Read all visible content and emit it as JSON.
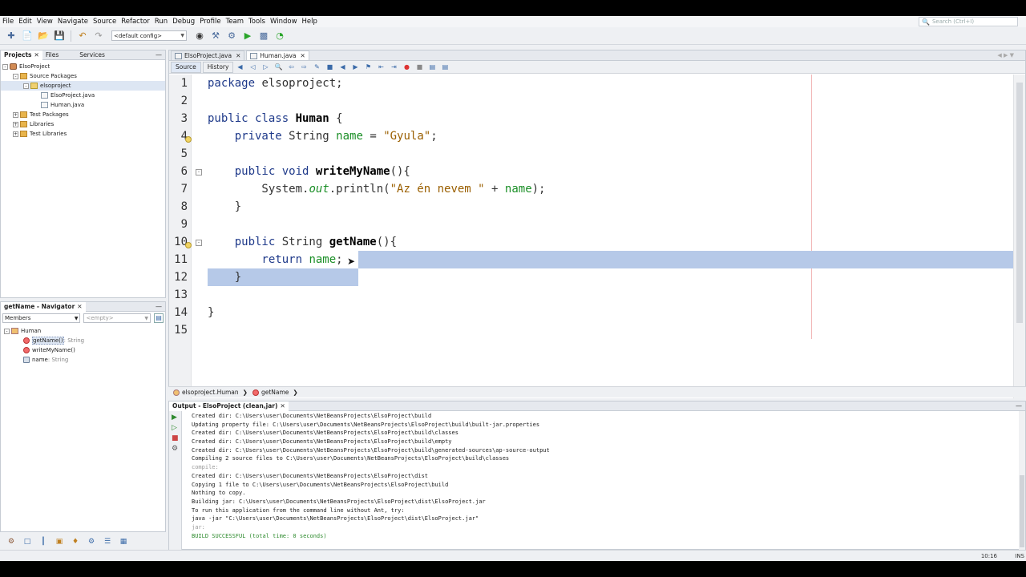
{
  "menu": [
    "File",
    "Edit",
    "View",
    "Navigate",
    "Source",
    "Refactor",
    "Run",
    "Debug",
    "Profile",
    "Team",
    "Tools",
    "Window",
    "Help"
  ],
  "search": {
    "placeholder": "Search (Ctrl+I)"
  },
  "toolbar": {
    "config": "<default config>"
  },
  "projects": {
    "tabs": [
      "Projects",
      "Files",
      "Services"
    ],
    "tree": [
      {
        "label": "ElsoProject",
        "indent": 0,
        "icon": "proj",
        "toggle": "-"
      },
      {
        "label": "Source Packages",
        "indent": 1,
        "icon": "folder",
        "toggle": "-"
      },
      {
        "label": "elsoproject",
        "indent": 2,
        "icon": "pkg",
        "toggle": "-",
        "selected": true
      },
      {
        "label": "ElsoProject.java",
        "indent": 3,
        "icon": "jfile",
        "toggle": ""
      },
      {
        "label": "Human.java",
        "indent": 3,
        "icon": "jfile",
        "toggle": ""
      },
      {
        "label": "Test Packages",
        "indent": 1,
        "icon": "folder",
        "toggle": "+"
      },
      {
        "label": "Libraries",
        "indent": 1,
        "icon": "folder",
        "toggle": "+"
      },
      {
        "label": "Test Libraries",
        "indent": 1,
        "icon": "folder",
        "toggle": "+"
      }
    ]
  },
  "navigator": {
    "tab": "getName - Navigator",
    "members": "Members",
    "filter": "<empty>",
    "class": "Human",
    "items": [
      {
        "name": "getName()",
        "type": " : String",
        "selected": true
      },
      {
        "name": "writeMyName()",
        "type": ""
      },
      {
        "name": "name",
        "type": " : String"
      }
    ]
  },
  "editor": {
    "tabs": [
      {
        "label": "ElsoProject.java",
        "active": false
      },
      {
        "label": "Human.java",
        "active": true
      }
    ],
    "source_tab": "Source",
    "history_tab": "History",
    "line_numbers": [
      "1",
      "2",
      "3",
      "4",
      "5",
      "6",
      "7",
      "8",
      "9",
      "10",
      "11",
      "12",
      "13",
      "14",
      "15"
    ],
    "code": {
      "l1_a": "package",
      "l1_b": " elsoproject;",
      "l3_a": "public class ",
      "l3_b": "Human",
      "l3_c": " {",
      "l4_a": "    private ",
      "l4_b": "String ",
      "l4_c": "name",
      "l4_d": " = ",
      "l4_e": "\"Gyula\"",
      "l4_f": ";",
      "l6_a": "    public void ",
      "l6_b": "writeMyName",
      "l6_c": "(){",
      "l7_a": "        System.",
      "l7_b": "out",
      "l7_c": ".println(",
      "l7_d": "\"Az én nevem \"",
      "l7_e": " + ",
      "l7_f": "name",
      "l7_g": ");",
      "l8": "    }",
      "l10_a": "    public ",
      "l10_b": "String ",
      "l10_c": "getName",
      "l10_d": "(){",
      "l11_a": "        return ",
      "l11_b": "name",
      "l11_c": ";",
      "l12": "    }",
      "l14": "}"
    }
  },
  "breadcrumb": [
    "elsoproject.Human",
    "getName"
  ],
  "output": {
    "tab": "Output - ElsoProject (clean,jar)",
    "lines": [
      {
        "t": "Created dir: C:\\Users\\user\\Documents\\NetBeansProjects\\ElsoProject\\build",
        "c": ""
      },
      {
        "t": "Updating property file: C:\\Users\\user\\Documents\\NetBeansProjects\\ElsoProject\\build\\built-jar.properties",
        "c": ""
      },
      {
        "t": "Created dir: C:\\Users\\user\\Documents\\NetBeansProjects\\ElsoProject\\build\\classes",
        "c": ""
      },
      {
        "t": "Created dir: C:\\Users\\user\\Documents\\NetBeansProjects\\ElsoProject\\build\\empty",
        "c": ""
      },
      {
        "t": "Created dir: C:\\Users\\user\\Documents\\NetBeansProjects\\ElsoProject\\build\\generated-sources\\ap-source-output",
        "c": ""
      },
      {
        "t": "Compiling 2 source files to C:\\Users\\user\\Documents\\NetBeansProjects\\ElsoProject\\build\\classes",
        "c": ""
      },
      {
        "t": "compile:",
        "c": "gray"
      },
      {
        "t": "Created dir: C:\\Users\\user\\Documents\\NetBeansProjects\\ElsoProject\\dist",
        "c": ""
      },
      {
        "t": "Copying 1 file to C:\\Users\\user\\Documents\\NetBeansProjects\\ElsoProject\\build",
        "c": ""
      },
      {
        "t": "Nothing to copy.",
        "c": ""
      },
      {
        "t": "Building jar: C:\\Users\\user\\Documents\\NetBeansProjects\\ElsoProject\\dist\\ElsoProject.jar",
        "c": ""
      },
      {
        "t": "To run this application from the command line without Ant, try:",
        "c": ""
      },
      {
        "t": "java -jar \"C:\\Users\\user\\Documents\\NetBeansProjects\\ElsoProject\\dist\\ElsoProject.jar\"",
        "c": ""
      },
      {
        "t": "jar:",
        "c": "gray"
      },
      {
        "t": "BUILD SUCCESSFUL (total time: 0 seconds)",
        "c": "green"
      }
    ]
  },
  "status": {
    "position": "10:16",
    "mode": "INS"
  }
}
